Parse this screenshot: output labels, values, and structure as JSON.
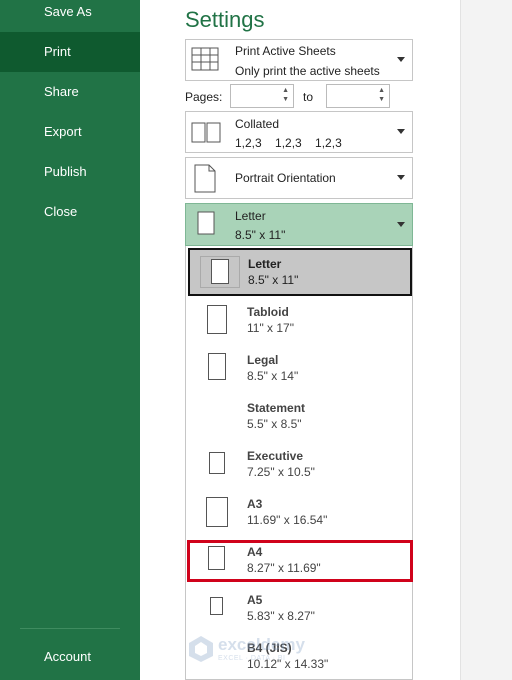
{
  "sidebar": {
    "items": [
      {
        "label": "Save As"
      },
      {
        "label": "Print"
      },
      {
        "label": "Share"
      },
      {
        "label": "Export"
      },
      {
        "label": "Publish"
      },
      {
        "label": "Close"
      }
    ],
    "account": "Account",
    "active": "Print",
    "color": "#217346"
  },
  "settings": {
    "title": "Settings",
    "print_what": {
      "title": "Print Active Sheets",
      "subtitle": "Only print the active sheets"
    },
    "pages": {
      "label": "Pages:",
      "to_label": "to",
      "from_value": "",
      "to_value": ""
    },
    "collation": {
      "title": "Collated",
      "subtitle": "1,2,3    1,2,3    1,2,3"
    },
    "orientation": {
      "title": "Portrait Orientation"
    },
    "paper": {
      "title": "Letter",
      "subtitle": "8.5\" x 11\"",
      "active_color": "#a9d3b8"
    }
  },
  "paper_sizes": [
    {
      "name": "Letter",
      "size": "8.5\" x 11\"",
      "selected": true
    },
    {
      "name": "Tabloid",
      "size": "11\" x 17\""
    },
    {
      "name": "Legal",
      "size": "8.5\" x 14\""
    },
    {
      "name": "Statement",
      "size": "5.5\" x 8.5\""
    },
    {
      "name": "Executive",
      "size": "7.25\" x 10.5\""
    },
    {
      "name": "A3",
      "size": "11.69\" x 16.54\""
    },
    {
      "name": "A4",
      "size": "8.27\" x 11.69\"",
      "highlighted": true
    },
    {
      "name": "A5",
      "size": "5.83\" x 8.27\""
    },
    {
      "name": "B4 (JIS)",
      "size": "10.12\" x 14.33\""
    }
  ],
  "watermark": {
    "text": "exceldemy",
    "sub": "EXCEL · DATA · BI"
  },
  "highlight_color": "#d0021b"
}
